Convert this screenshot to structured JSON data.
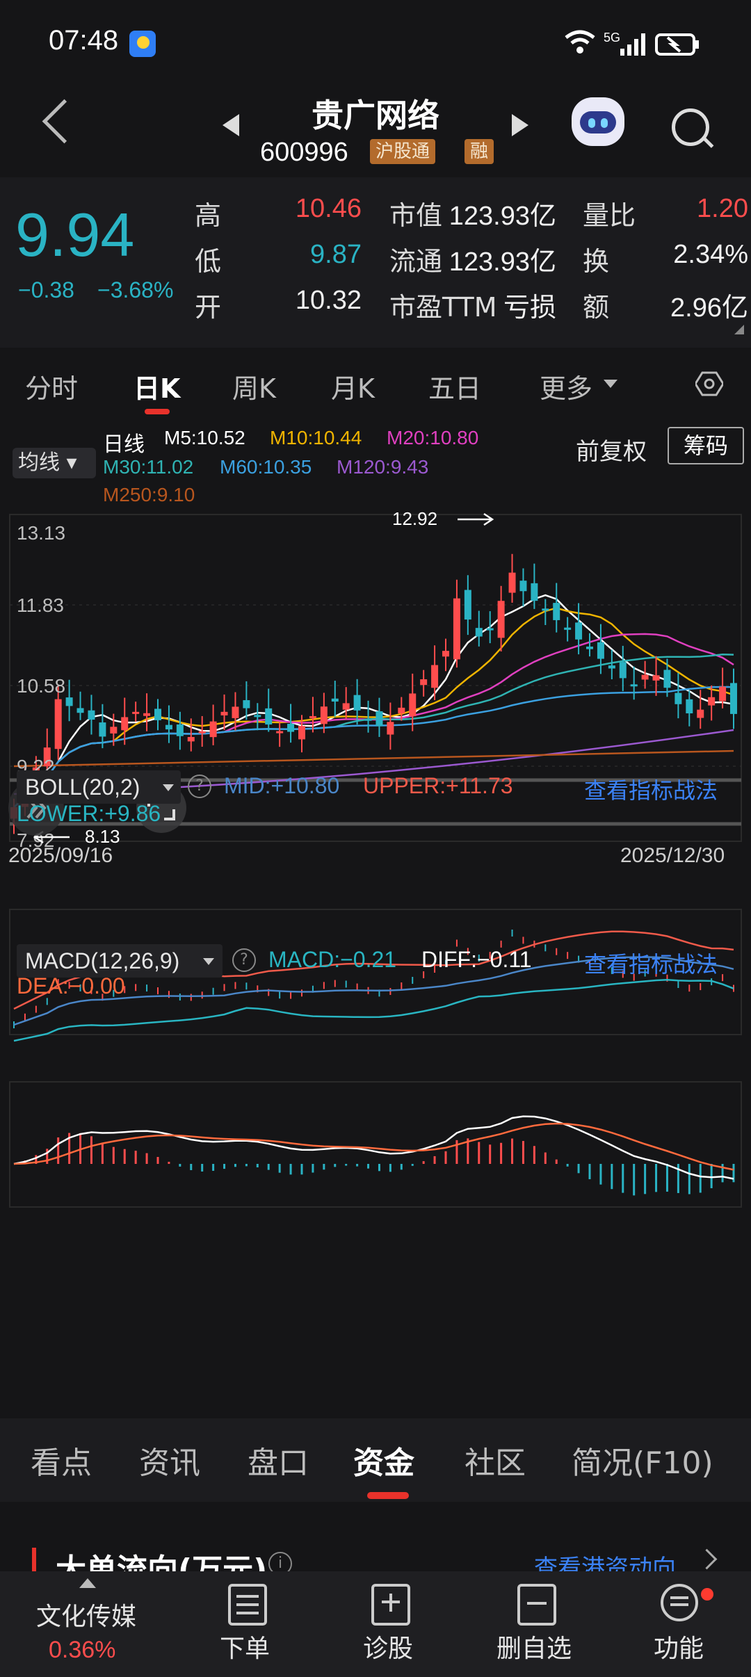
{
  "status": {
    "time": "07:48",
    "network": "5G"
  },
  "header": {
    "title": "贵广网络",
    "code": "600996",
    "tag1": "沪股通",
    "tag2": "融"
  },
  "quote": {
    "price": "9.94",
    "change": "−0.38",
    "change_pct": "−3.68%",
    "high_label": "高",
    "high": "10.46",
    "low_label": "低",
    "low": "9.87",
    "open_label": "开",
    "open": "10.32",
    "mcap_label": "市值",
    "mcap": "123.93亿",
    "float_label": "流通",
    "float": "123.93亿",
    "pe_label": "市盈TTM",
    "pe": "亏损",
    "vr_label": "量比",
    "vr": "1.20",
    "turnover_label": "换",
    "turnover": "2.34%",
    "amount_label": "额",
    "amount": "2.96亿"
  },
  "ktabs": {
    "t1": "分时",
    "t2": "日K",
    "t3": "周K",
    "t4": "月K",
    "t5": "五日",
    "t6": "更多"
  },
  "kline": {
    "ma_selector": "均线",
    "period": "日线",
    "m5": "M5:10.52",
    "m10": "M10:10.44",
    "m20": "M20:10.80",
    "m30": "M30:11.02",
    "m60": "M60:10.35",
    "m120": "M120:9.43",
    "m250": "M250:9.10",
    "adjust": "前复权",
    "chip": "筹码",
    "y_labels": [
      "13.13",
      "11.83",
      "10.58",
      "9.22",
      "7.92"
    ],
    "max_label": "12.92",
    "min_label": "8.13",
    "date_start": "2025/09/16",
    "date_end": "2025/12/30"
  },
  "boll": {
    "name": "BOLL(20,2)",
    "mid": "MID:+10.80",
    "upper": "UPPER:+11.73",
    "lower": "LOWER:+9.86",
    "link": "查看指标战法"
  },
  "macd": {
    "name": "MACD(12,26,9)",
    "macd": "MACD:−0.21",
    "diff": "DIFF:−0.11",
    "dea": "DEA:−0.00",
    "link": "查看指标战法"
  },
  "btabs": {
    "t1": "看点",
    "t2": "资讯",
    "t3": "盘口",
    "t4": "资金",
    "t5": "社区",
    "t6": "简况(F10)"
  },
  "section": {
    "title": "大单流向(万元)",
    "link": "查看港资动向"
  },
  "bottomnav": {
    "sector": "文化传媒",
    "sector_pct": "0.36%",
    "b1": "下单",
    "b2": "诊股",
    "b3": "删自选",
    "b4": "功能"
  },
  "colors": {
    "up": "#ff4d4d",
    "down": "#2ab3c4",
    "accent": "#e8322b",
    "link": "#3b82f6"
  }
}
